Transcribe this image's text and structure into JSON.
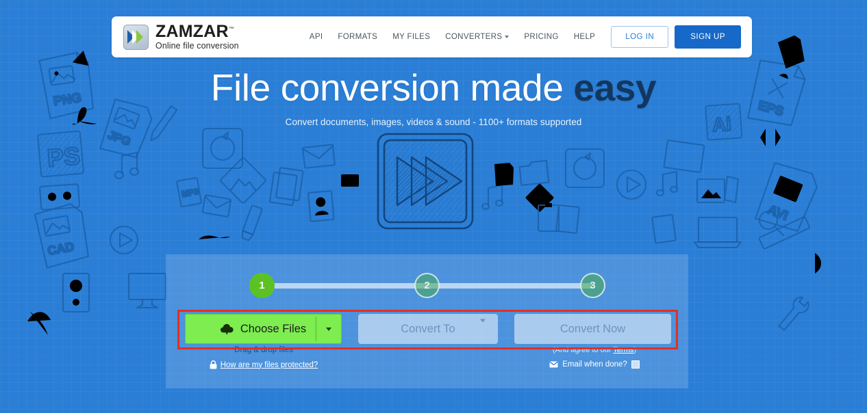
{
  "site": {
    "logo_name": "ZAMZAR",
    "logo_tm": "™",
    "logo_tagline": "Online file conversion"
  },
  "nav": {
    "items": [
      {
        "label": "API",
        "has_caret": false
      },
      {
        "label": "FORMATS",
        "has_caret": false
      },
      {
        "label": "MY FILES",
        "has_caret": false
      },
      {
        "label": "CONVERTERS",
        "has_caret": true
      },
      {
        "label": "PRICING",
        "has_caret": false
      },
      {
        "label": "HELP",
        "has_caret": false
      }
    ],
    "login_label": "LOG IN",
    "signup_label": "SIGN UP"
  },
  "hero": {
    "title_plain": "File conversion made ",
    "title_accent": "easy",
    "subtitle": "Convert documents, images, videos & sound - 1100+ formats supported"
  },
  "panel": {
    "steps": [
      {
        "number": "1",
        "state": "active"
      },
      {
        "number": "2",
        "state": "inactive"
      },
      {
        "number": "3",
        "state": "inactive"
      }
    ],
    "choose_files_label": "Choose Files",
    "choose_files_icon": "cloud-upload-icon",
    "choose_files_caret": "chevron-down-icon",
    "convert_to_label": "Convert To",
    "convert_to_caret": "chevron-down-icon",
    "convert_now_label": "Convert Now",
    "drag_drop_label": "Drag & drop files",
    "protected_icon": "lock-icon",
    "protected_link": "How are my files protected?",
    "terms_prefix": "(And agree to our ",
    "terms_link": "Terms",
    "terms_suffix": ")",
    "email_icon": "envelope-icon",
    "email_label": "Email when done?",
    "email_checked": false
  },
  "decor": {
    "center_icon": "fast-forward-play-icon",
    "background_doodles": [
      "PNG",
      "JPG",
      "PS",
      "CAD",
      "EPS",
      "Ai",
      "AVI",
      "MP3"
    ]
  },
  "colors": {
    "background_blue": "#2a7ed6",
    "doodle_stroke": "#1b5fa8",
    "accent_navy": "#13365f",
    "primary_blue": "#1668c9",
    "green_active": "#5cc223",
    "green_button": "#7ded4f",
    "highlight_red": "#e03024",
    "muted_text": "#6d93bd"
  }
}
